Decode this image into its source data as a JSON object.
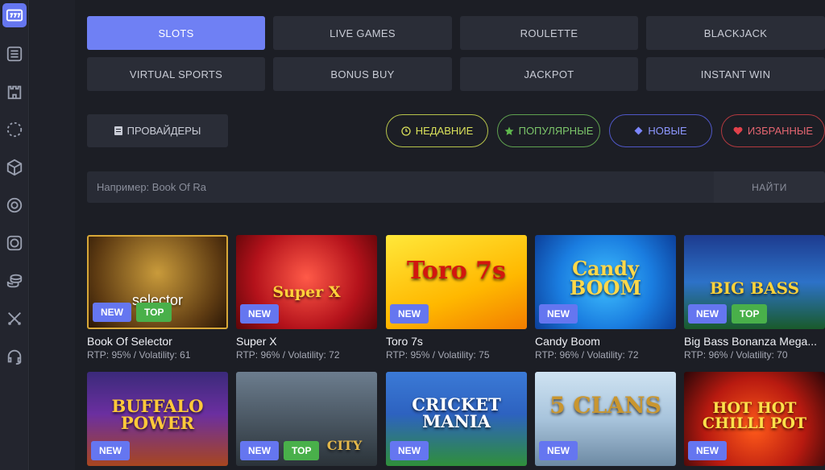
{
  "colors": {
    "accent": "#6f80f4",
    "badge_new": "#6576f0",
    "badge_top": "#49b04a",
    "recent": "#d9e05a",
    "popular": "#7cc56a",
    "new": "#8d97ff",
    "favorites": "#e36570"
  },
  "sidebar": {
    "icons": [
      "slots-777-icon",
      "list-icon",
      "castle-icon",
      "dotted-circle-icon",
      "dice-icon",
      "roulette-icon",
      "bingo-40-icon",
      "coins-stack-icon",
      "crossed-swords-icon",
      "headset-icon"
    ]
  },
  "categories": [
    "SLOTS",
    "LIVE GAMES",
    "ROULETTE",
    "BLACKJACK",
    "VIRTUAL SPORTS",
    "BONUS BUY",
    "JACKPOT",
    "INSTANT WIN"
  ],
  "providers": {
    "label": "ПРОВАЙДЕРЫ"
  },
  "filters": {
    "recent": "НЕДАВНИЕ",
    "popular": "ПОПУЛЯРНЫЕ",
    "new": "НОВЫЕ",
    "favorites": "ИЗБРАННЫЕ"
  },
  "search": {
    "placeholder": "Например: Book Of Ra",
    "button": "НАЙТИ"
  },
  "badges": {
    "new": "NEW",
    "top": "TOP"
  },
  "games": [
    {
      "title": "Book Of Selector",
      "meta": "RTP: 95% / Volatility: 61",
      "art": "selector"
    },
    {
      "title": "Super X",
      "meta": "RTP: 96% / Volatility: 72",
      "art": "Super X"
    },
    {
      "title": "Toro 7s",
      "meta": "RTP: 95% / Volatility: 75",
      "art": "Toro 7s"
    },
    {
      "title": "Candy Boom",
      "meta": "RTP: 96% / Volatility: 72",
      "art": "Candy BOOM"
    },
    {
      "title": "Big Bass Bonanza Mega...",
      "meta": "RTP: 96% / Volatility: 70",
      "art": "BIG BASS"
    },
    {
      "art": "BUFFALO POWER"
    },
    {
      "art": "CITY"
    },
    {
      "art": "CRICKET MANIA"
    },
    {
      "art": "5 CLANS"
    },
    {
      "art": "HOT HOT CHILLI POT"
    }
  ]
}
